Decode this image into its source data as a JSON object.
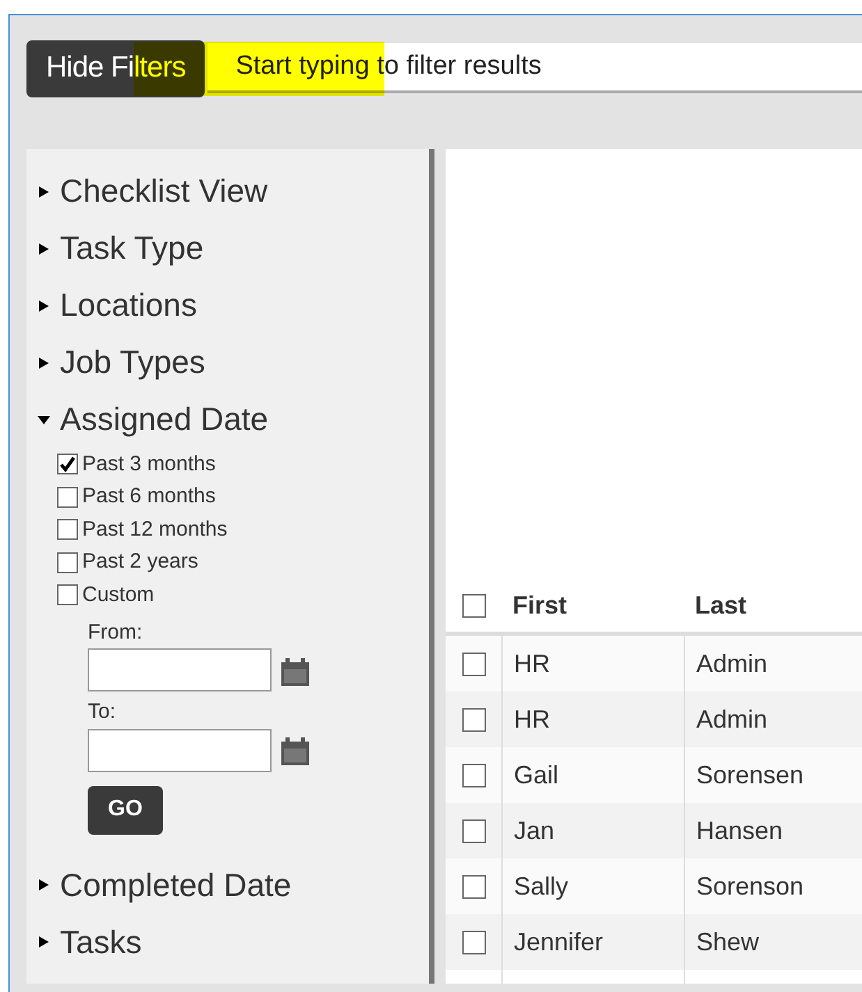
{
  "toggle_button": "Hide Filters",
  "search": {
    "placeholder": "Start typing to filter results"
  },
  "filters": [
    {
      "label": "Checklist View",
      "expanded": false
    },
    {
      "label": "Task Type",
      "expanded": false
    },
    {
      "label": "Locations",
      "expanded": false
    },
    {
      "label": "Job Types",
      "expanded": false
    },
    {
      "label": "Assigned Date",
      "expanded": true,
      "options": [
        {
          "label": "Past 3 months",
          "checked": true
        },
        {
          "label": "Past 6 months",
          "checked": false
        },
        {
          "label": "Past 12 months",
          "checked": false
        },
        {
          "label": "Past 2 years",
          "checked": false
        },
        {
          "label": "Custom",
          "checked": false
        }
      ],
      "from_label": "From:",
      "to_label": "To:",
      "go_button": "GO"
    },
    {
      "label": "Completed Date",
      "expanded": false
    },
    {
      "label": "Tasks",
      "expanded": false
    }
  ],
  "table": {
    "header_checked": false,
    "columns": [
      "First",
      "Last"
    ],
    "rows": [
      {
        "checked": false,
        "cells": [
          "HR",
          "Admin"
        ]
      },
      {
        "checked": false,
        "cells": [
          "HR",
          "Admin"
        ]
      },
      {
        "checked": false,
        "cells": [
          "Gail",
          "Sorensen"
        ]
      },
      {
        "checked": false,
        "cells": [
          "Jan",
          "Hansen"
        ]
      },
      {
        "checked": false,
        "cells": [
          "Sally",
          "Sorenson"
        ]
      },
      {
        "checked": false,
        "cells": [
          "Jennifer",
          "Shew"
        ]
      }
    ]
  }
}
